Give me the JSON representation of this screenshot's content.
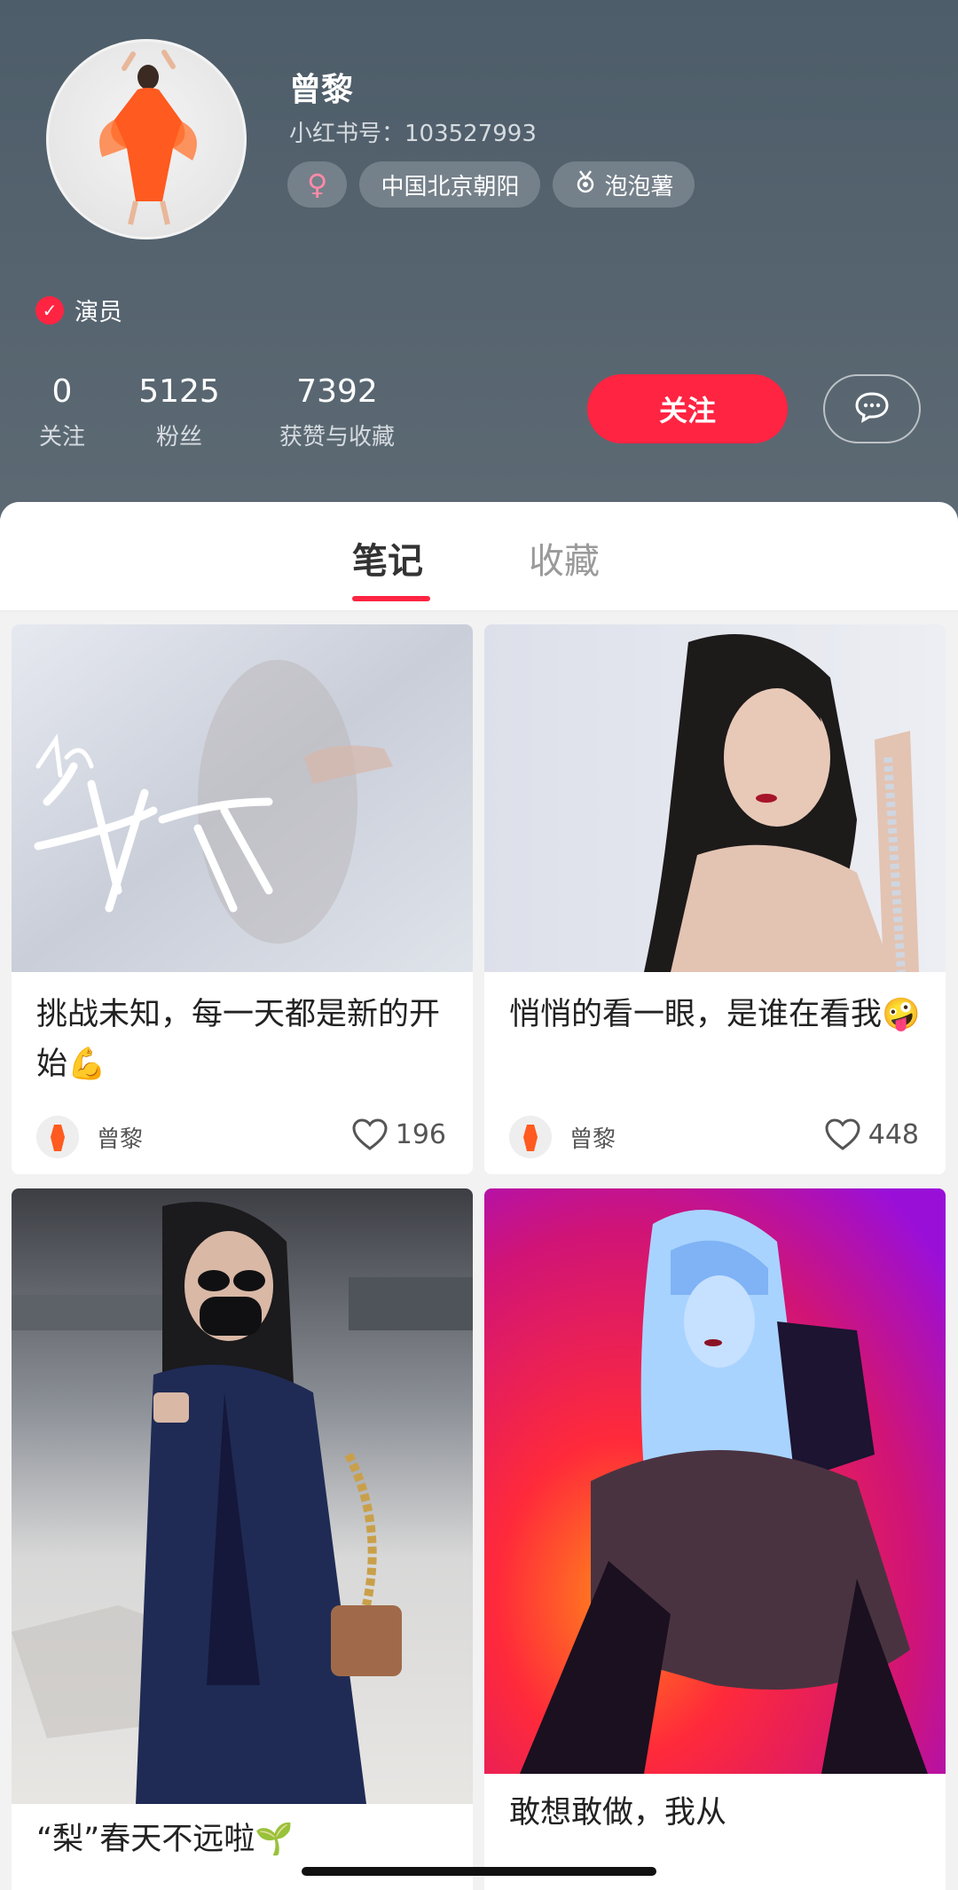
{
  "profile": {
    "name": "曾黎",
    "xhs_id": "小红书号：103527993",
    "gender_symbol": "♀",
    "location": "中国北京朝阳",
    "badge": "泡泡薯",
    "badge_icon": "medal-icon",
    "verification": "演员"
  },
  "stats": [
    {
      "value": "0",
      "label": "关注"
    },
    {
      "value": "5125",
      "label": "粉丝"
    },
    {
      "value": "7392",
      "label": "获赞与收藏"
    }
  ],
  "actions": {
    "follow_label": "关注",
    "message_icon": "chat-bubble-icon"
  },
  "tabs": [
    {
      "label": "笔记",
      "active": true
    },
    {
      "label": "收藏",
      "active": false
    }
  ],
  "notes": [
    {
      "title": "挑战未知，每一天都是新的开始💪",
      "author": "曾黎",
      "likes": "196"
    },
    {
      "title": "悄悄的看一眼，是谁在看我🤪",
      "author": "曾黎",
      "likes": "448"
    },
    {
      "title": "“梨”春天不远啦🌱",
      "author": "",
      "likes": ""
    },
    {
      "title": "敢想敢做，我从",
      "author": "",
      "likes": ""
    }
  ],
  "colors": {
    "accent": "#ff2442",
    "header_bg": "#4d5d69"
  }
}
